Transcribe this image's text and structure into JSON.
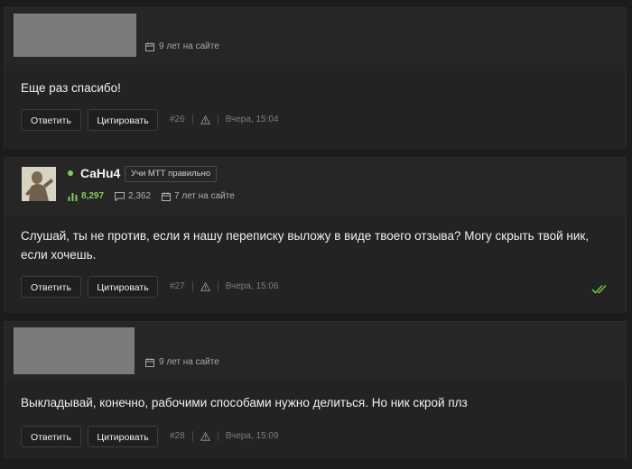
{
  "posts": [
    {
      "join": "9 лет на сайте",
      "message": "Еще раз спасибо!",
      "reply_label": "Ответить",
      "quote_label": "Цитировать",
      "number": "#26",
      "time": "Вчера, 15:04"
    },
    {
      "username": "CaHu4",
      "badge": "Учи МТТ правильно",
      "rating": "8,297",
      "messages": "2,362",
      "join": "7 лет на сайте",
      "message": " Слушай, ты не против, если я нашу переписку выложу в виде твоего отзыва? Могу скрыть твой ник, если хочешь.",
      "reply_label": "Ответить",
      "quote_label": "Цитировать",
      "number": "#27",
      "time": "Вчера, 15:06",
      "read_icon": "double-check-icon"
    },
    {
      "join": "9 лет на сайте",
      "message": "Выкладывай, конечно, рабочими способами нужно делиться. Но ник скрой плз",
      "reply_label": "Ответить",
      "quote_label": "Цитировать",
      "number": "#28",
      "time": "Вчера, 15:09"
    }
  ],
  "colors": {
    "background": "#1c1c1c",
    "accent_green": "#7ccf5c",
    "read_check": "#6cbf3f"
  }
}
